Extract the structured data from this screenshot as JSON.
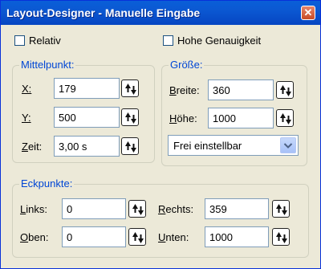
{
  "window": {
    "title": "Layout-Designer - Manuelle Eingabe",
    "close_glyph": "✕"
  },
  "checkboxes": {
    "relativ": {
      "label": "Relativ",
      "checked": false
    },
    "hohe_genauigkeit": {
      "label": "Hohe Genauigkeit",
      "checked": false
    }
  },
  "mittelpunkt": {
    "title": "Mittelpunkt:",
    "x": {
      "label": "X:",
      "value": "179"
    },
    "y": {
      "label": "Y:",
      "value": "500"
    },
    "zeit": {
      "label": "Zeit:",
      "value": "3,00 s"
    }
  },
  "groesse": {
    "title": "Größe:",
    "breite": {
      "label": "Breite:",
      "value": "360"
    },
    "hoehe": {
      "label": "Höhe:",
      "value": "1000"
    },
    "mode": {
      "selected": "Frei einstellbar"
    }
  },
  "eckpunkte": {
    "title": "Eckpunkte:",
    "links": {
      "label": "Links:",
      "value": "0"
    },
    "rechts": {
      "label": "Rechts:",
      "value": "359"
    },
    "oben": {
      "label": "Oben:",
      "value": "0"
    },
    "unten": {
      "label": "Unten:",
      "value": "1000"
    }
  },
  "icons": {
    "spinner": "spinner-up-down-icon",
    "dropdown": "chevron-down-icon",
    "close": "close-icon"
  },
  "colors": {
    "titlebar": "#0a5fd8",
    "group_title": "#0046d5",
    "dialog_bg": "#ece9d8",
    "close_button": "#c84a25"
  }
}
